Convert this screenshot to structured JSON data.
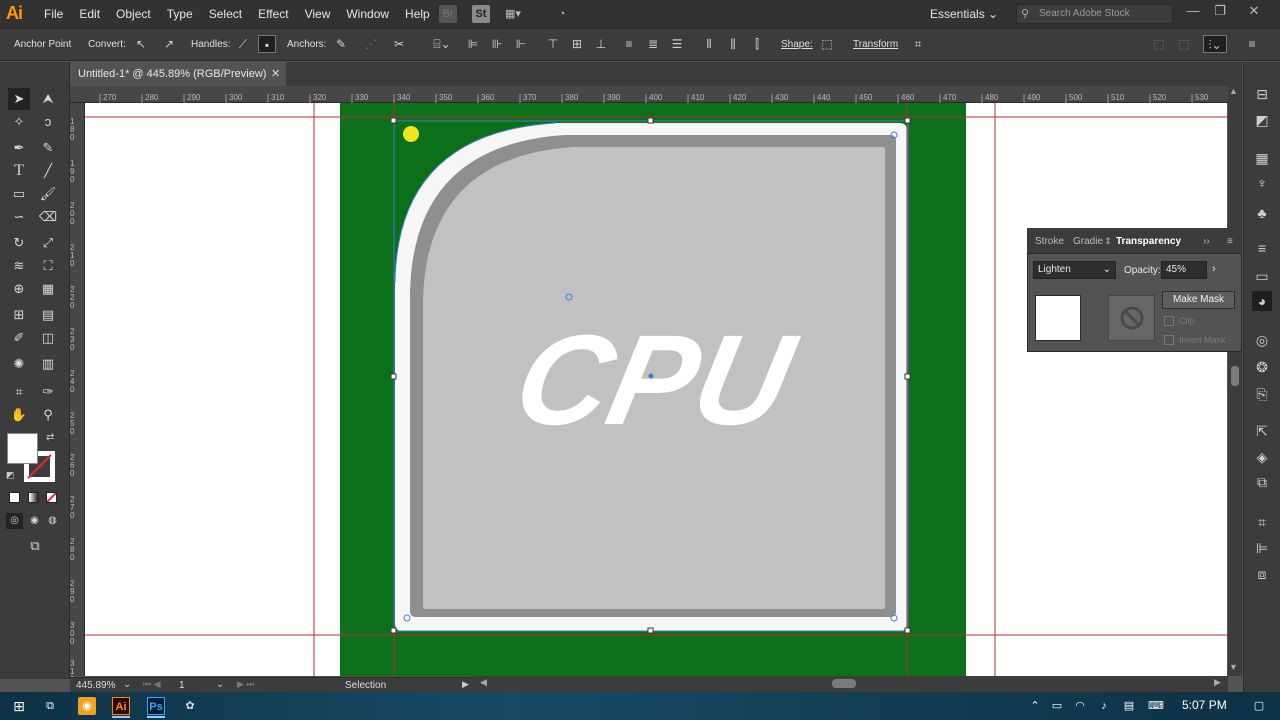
{
  "app": {
    "logo": "Ai",
    "menus": [
      "File",
      "Edit",
      "Object",
      "Type",
      "Select",
      "Effect",
      "View",
      "Window",
      "Help"
    ],
    "toolbar_icons": {
      "bridge": "Br",
      "stock": "St"
    },
    "workspace": "Essentials",
    "search_placeholder": "Search Adobe Stock"
  },
  "control_bar": {
    "anchor_point": "Anchor Point",
    "convert": "Convert:",
    "handles": "Handles:",
    "anchors": "Anchors:",
    "shape": "Shape:",
    "transform": "Transform"
  },
  "document": {
    "tab_title": "Untitled-1* @ 445.89% (RGB/Preview)"
  },
  "ruler": {
    "h_ticks": [
      "270",
      "280",
      "290",
      "300",
      "310",
      "320",
      "330",
      "340",
      "350",
      "360",
      "370",
      "380",
      "390",
      "400",
      "410",
      "420",
      "430",
      "440",
      "450",
      "460",
      "470",
      "480",
      "490",
      "500",
      "510",
      "520",
      "530"
    ],
    "v_ticks": [
      "180",
      "190",
      "200",
      "210",
      "220",
      "230",
      "240",
      "250",
      "260",
      "270",
      "280",
      "290",
      "300",
      "310"
    ]
  },
  "artwork": {
    "text": "CPU",
    "colors": {
      "background": "#0b7019",
      "outer": "#f5f6f5",
      "inner_border": "#8f8f8f",
      "inner_fill": "#c2c1c2",
      "guide": "#b03030",
      "selection": "#4a7ad0",
      "yellow_dot": "#f5e41a"
    }
  },
  "transparency_panel": {
    "tabs": [
      "Stroke",
      "Gradie",
      "Transparency"
    ],
    "blend_mode": "Lighten",
    "opacity_label": "Opacity:",
    "opacity_value": "45%",
    "make_mask": "Make Mask",
    "clip": "Clip",
    "invert_mask": "Invert Mask"
  },
  "status_bar": {
    "zoom": "445.89%",
    "artboard": "1",
    "status": "Selection"
  },
  "taskbar": {
    "time": "5:07 PM",
    "apps": [
      "Ai",
      "Ps"
    ]
  }
}
